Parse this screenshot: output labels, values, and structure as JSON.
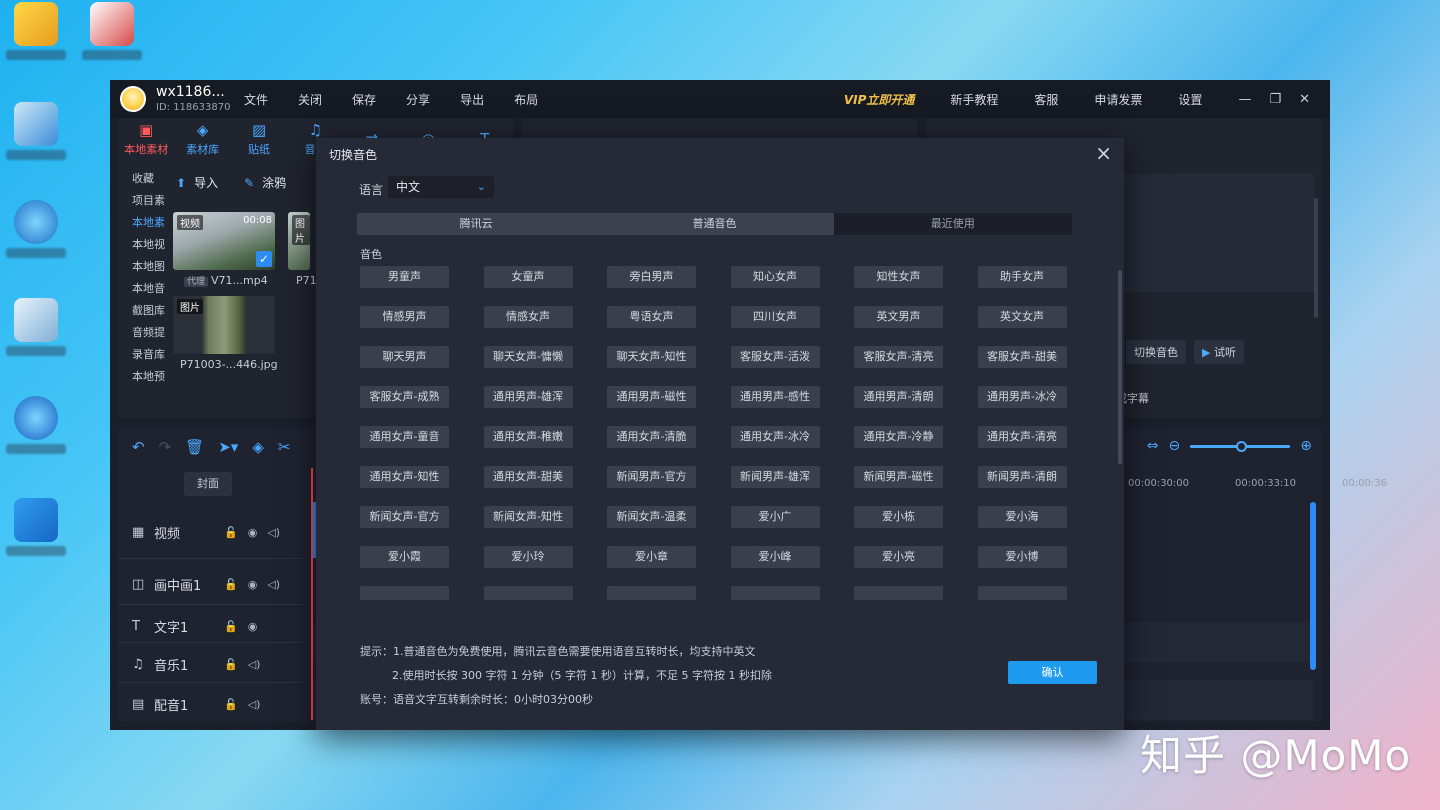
{
  "watermark": "知乎 @MoMo",
  "colors": {
    "accent": "#1e9bef",
    "vip": "#f2c04a",
    "playhead": "#ff4a4a"
  },
  "titlebar": {
    "user_name": "wx1186...",
    "user_id": "ID: 118633870",
    "menu": [
      "文件",
      "关闭",
      "保存",
      "分享",
      "导出",
      "布局"
    ],
    "vip": "VIP立即开通",
    "right_menu": [
      "新手教程",
      "客服",
      "申请发票",
      "设置"
    ]
  },
  "media": {
    "tools": [
      "本地素材",
      "素材库",
      "贴纸",
      "音乐"
    ],
    "side": [
      "收藏",
      "项目素",
      "本地素",
      "本地视",
      "本地图",
      "本地音",
      "截图库",
      "音频提",
      "录音库",
      "本地预"
    ],
    "import_label": "导入",
    "paint_label": "涂鸦",
    "video_tag": "视频",
    "video_duration": "00:08",
    "proxy_tag": "代理",
    "video_name": "V71...mp4",
    "video_name2": "P71",
    "image_tag": "图片",
    "image_tag2": "图片",
    "image_name": "P71003-...446.jpg"
  },
  "props": {
    "switch_voice": "切换音色",
    "preview": "试听",
    "subtitle_tail": "成字幕"
  },
  "timeline": {
    "cover": "封面",
    "ruler": [
      "00:00:30:00",
      "00:00:33:10",
      "00:00:36"
    ],
    "tracks": [
      "视频",
      "画中画1",
      "文字1",
      "音乐1",
      "配音1"
    ]
  },
  "modal": {
    "title": "切换音色",
    "lang_label": "语言",
    "lang_value": "中文",
    "tabs": [
      "腾讯云",
      "普通音色",
      "最近使用"
    ],
    "voice_label": "音色",
    "voices": [
      "男童声",
      "女童声",
      "旁白男声",
      "知心女声",
      "知性女声",
      "助手女声",
      "情感男声",
      "情感女声",
      "粤语女声",
      "四川女声",
      "英文男声",
      "英文女声",
      "聊天男声",
      "聊天女声-慵懒",
      "聊天女声-知性",
      "客服女声-活泼",
      "客服女声-清亮",
      "客服女声-甜美",
      "客服女声-成熟",
      "通用男声-雄浑",
      "通用男声-磁性",
      "通用男声-感性",
      "通用男声-清朗",
      "通用男声-冰冷",
      "通用女声-童音",
      "通用女声-稚嫩",
      "通用女声-清脆",
      "通用女声-冰冷",
      "通用女声-冷静",
      "通用女声-清亮",
      "通用女声-知性",
      "通用女声-甜美",
      "新闻男声-官方",
      "新闻男声-雄浑",
      "新闻男声-磁性",
      "新闻男声-清朗",
      "新闻女声-官方",
      "新闻女声-知性",
      "新闻女声-温柔",
      "爱小广",
      "爱小栋",
      "爱小海",
      "爱小霞",
      "爱小玲",
      "爱小章",
      "爱小峰",
      "爱小亮",
      "爱小博",
      "",
      "",
      "",
      "",
      "",
      ""
    ],
    "tip1": "提示：1.普通音色为免费使用，腾讯云音色需要使用语音互转时长，均支持中英文",
    "tip2": "2.使用时长按 300 字符 1 分钟（5 字符 1 秒）计算，不足 5 字符按 1 秒扣除",
    "account": "账号：语音文字互转剩余时长：0小时03分00秒",
    "confirm": "确认"
  }
}
